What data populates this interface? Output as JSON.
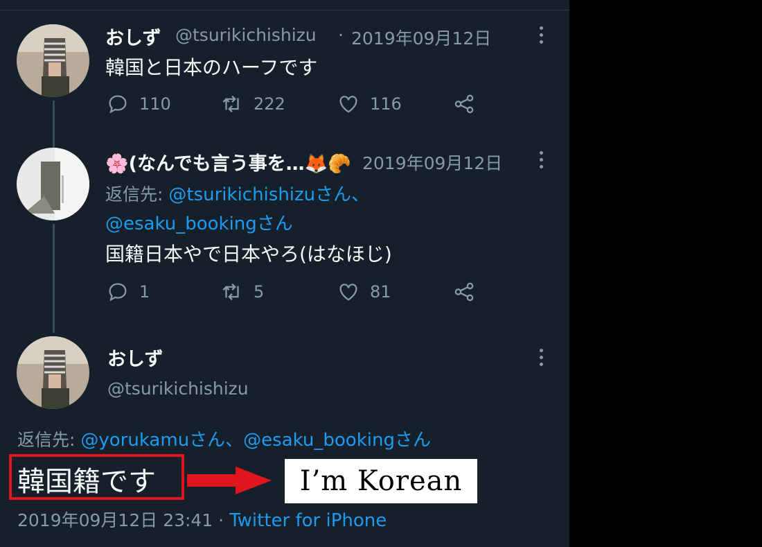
{
  "tweets": [
    {
      "display_name": "おしず",
      "handle": "@tsurikichishizu",
      "separator": "·",
      "date": "2019年09月12日",
      "text": "韓国と日本のハーフです",
      "replies": "110",
      "retweets": "222",
      "likes": "116"
    },
    {
      "display_name": "🌸(なんでも言う事を…🦊🥐",
      "date": "2019年09月12日",
      "reply_prefix": "返信先: ",
      "reply_to_1": "@tsurikichishizuさん、",
      "reply_to_2": "@esaku_bookingさん",
      "text": "国籍日本やで日本やろ(はなほじ)",
      "replies": "1",
      "retweets": "5",
      "likes": "81"
    }
  ],
  "main_tweet": {
    "display_name": "おしず",
    "handle": "@tsurikichishizu",
    "reply_prefix": "返信先: ",
    "reply_to": "@yorukamuさん、@esaku_bookingさん",
    "text": "韓国籍です",
    "timestamp": "2019年09月12日 23:41 · ",
    "source": "Twitter for iPhone"
  },
  "annotation": {
    "translation": "I’m Korean",
    "highlight_color": "#e0151d"
  },
  "colors": {
    "background": "#15202b",
    "link": "#1d9bf0",
    "muted": "#8b98a5"
  }
}
